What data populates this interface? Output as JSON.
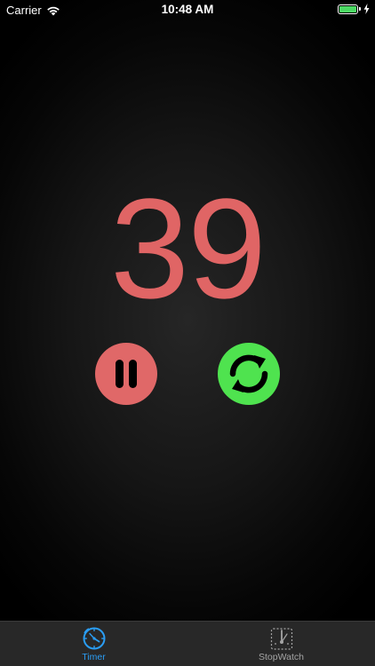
{
  "status_bar": {
    "carrier": "Carrier",
    "time": "10:48 AM",
    "battery_color": "#4cd964",
    "icons": [
      "wifi-icon",
      "battery-icon",
      "charging-bolt-icon"
    ]
  },
  "timer": {
    "value": "39",
    "color": "#e06565"
  },
  "controls": {
    "pause": {
      "icon": "pause-icon",
      "color": "#e06868"
    },
    "reset": {
      "icon": "refresh-icon",
      "color": "#4fe34f"
    }
  },
  "tab_bar": {
    "tabs": [
      {
        "label": "Timer",
        "icon": "timer-icon",
        "selected": true,
        "color": "#2a9df4"
      },
      {
        "label": "StopWatch",
        "icon": "stopwatch-icon",
        "selected": false,
        "color": "#a5a5a5"
      }
    ]
  }
}
